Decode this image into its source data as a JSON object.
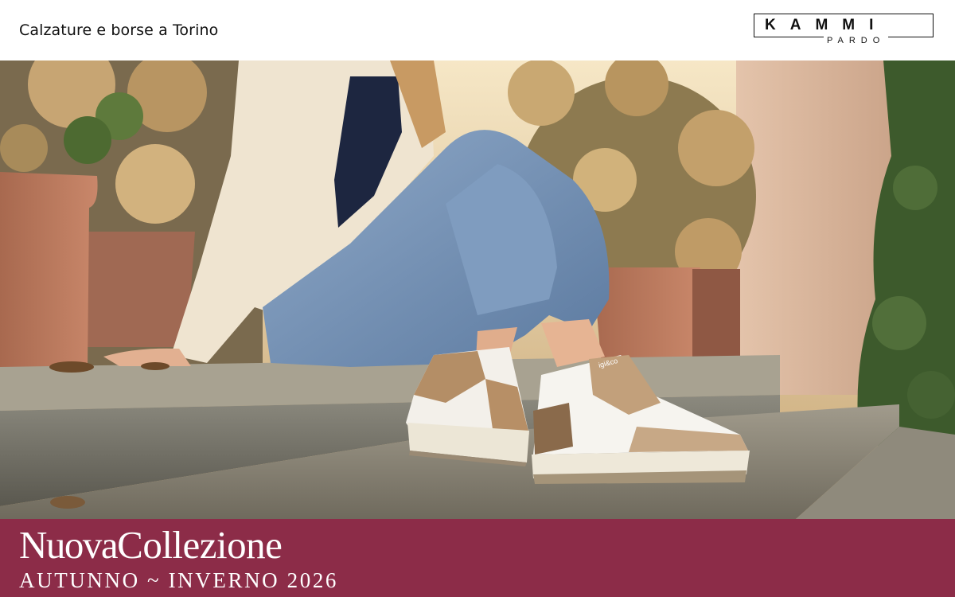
{
  "header": {
    "tagline": "Calzature e borse a Torino",
    "logo": {
      "main": "KAMMI",
      "sub": "PARDO"
    }
  },
  "hero": {
    "shoe_brand": "igi&co"
  },
  "banner": {
    "title_part1": "Nuova",
    "title_part2": "Collezione",
    "subtitle": "AUTUNNO ~ INVERNO 2026",
    "background_color": "#8c2c48"
  }
}
